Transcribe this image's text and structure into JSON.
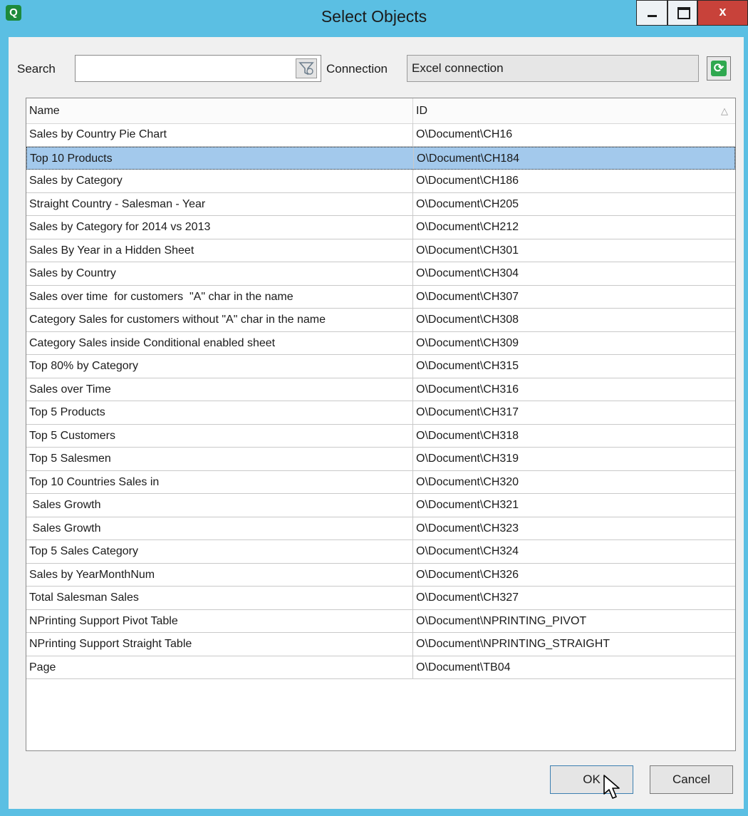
{
  "window": {
    "title": "Select Objects",
    "app_icon_letter": "Q",
    "close_glyph": "x"
  },
  "search": {
    "label": "Search",
    "value": "",
    "placeholder": ""
  },
  "connection": {
    "label": "Connection",
    "value": "Excel connection"
  },
  "table": {
    "columns": [
      "Name",
      "ID"
    ],
    "sort_indicator": "△",
    "rows": [
      {
        "name": "Sales by Country Pie Chart",
        "id": "O\\Document\\CH16"
      },
      {
        "name": "Top 10 Products",
        "id": "O\\Document\\CH184"
      },
      {
        "name": "Sales by Category",
        "id": "O\\Document\\CH186"
      },
      {
        "name": "Straight Country - Salesman - Year",
        "id": "O\\Document\\CH205"
      },
      {
        "name": "Sales by Category for 2014 vs 2013",
        "id": "O\\Document\\CH212"
      },
      {
        "name": "Sales By Year in a Hidden Sheet",
        "id": "O\\Document\\CH301"
      },
      {
        "name": "Sales by Country",
        "id": "O\\Document\\CH304"
      },
      {
        "name": "Sales over time  for customers  \"A\" char in the name",
        "id": "O\\Document\\CH307"
      },
      {
        "name": "Category Sales for customers without \"A\" char in the name",
        "id": "O\\Document\\CH308"
      },
      {
        "name": "Category Sales inside Conditional enabled sheet",
        "id": "O\\Document\\CH309"
      },
      {
        "name": "Top 80% by Category",
        "id": "O\\Document\\CH315"
      },
      {
        "name": "Sales over Time",
        "id": "O\\Document\\CH316"
      },
      {
        "name": "Top 5 Products",
        "id": "O\\Document\\CH317"
      },
      {
        "name": "Top 5 Customers",
        "id": "O\\Document\\CH318"
      },
      {
        "name": "Top 5 Salesmen",
        "id": "O\\Document\\CH319"
      },
      {
        "name": "Top 10 Countries Sales in",
        "id": "O\\Document\\CH320"
      },
      {
        "name": " Sales Growth",
        "id": "O\\Document\\CH321"
      },
      {
        "name": " Sales Growth",
        "id": "O\\Document\\CH323"
      },
      {
        "name": "Top 5 Sales Category",
        "id": "O\\Document\\CH324"
      },
      {
        "name": "Sales by YearMonthNum",
        "id": "O\\Document\\CH326"
      },
      {
        "name": "Total Salesman Sales",
        "id": "O\\Document\\CH327"
      },
      {
        "name": "NPrinting Support Pivot Table",
        "id": "O\\Document\\NPRINTING_PIVOT"
      },
      {
        "name": "NPrinting Support Straight Table",
        "id": "O\\Document\\NPRINTING_STRAIGHT"
      },
      {
        "name": "Page",
        "id": "O\\Document\\TB04"
      }
    ],
    "selected_index": 1
  },
  "buttons": {
    "ok": "OK",
    "cancel": "Cancel"
  },
  "colors": {
    "titlebar": "#5bbfe3",
    "selection": "#a3c9ec",
    "close_button": "#c8423a"
  },
  "icons": {
    "app": "qlik-icon",
    "filter": "filter-icon",
    "refresh": "refresh-icon",
    "minimize": "minimize-icon",
    "maximize": "maximize-icon",
    "close": "close-icon",
    "cursor": "mouse-pointer-icon"
  }
}
